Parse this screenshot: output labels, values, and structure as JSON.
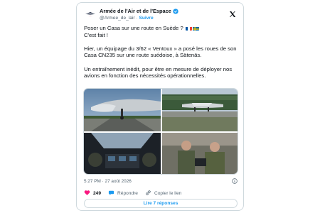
{
  "author": {
    "display_name": "Armée de l'Air et de l'Espace",
    "handle": "@Armee_de_lair",
    "follow_label": "Suivre",
    "separator": "·",
    "avatar": "armee-air-espace-logo-icon",
    "verified_icon": "verified-badge-icon"
  },
  "post": {
    "line1": "Poser un Casa sur une route en Suède ? ",
    "line2": "C'est fait !",
    "paragraph2": "Hier, un équipage du 3/62 « Ventoux » a posé les roues de son Casa CN235 sur une route suédoise, à Sätenäs.",
    "paragraph3": "Un entraînement inédit, pour être en mesure de déployer nos avions en fonction des nécessités opérationnelles.",
    "flags": [
      "france-flag-icon",
      "sweden-flag-icon"
    ]
  },
  "media": {
    "photos": [
      "aircraft-nose-over-runway-photo",
      "aircraft-on-road-photo",
      "cockpit-crew-photo",
      "crew-with-tablet-photo"
    ]
  },
  "meta": {
    "time": "5:27 PM",
    "separator": "·",
    "date": "27 août 2026"
  },
  "actions": {
    "like_count": "249",
    "reply_label": "Répondre",
    "copy_label": "Copier le lien"
  },
  "replies_button": {
    "label": "Lire 7 réponses"
  },
  "colors": {
    "link": "#1d9bf0",
    "like": "#f91880",
    "muted": "#536471",
    "border": "#cfd9de"
  }
}
